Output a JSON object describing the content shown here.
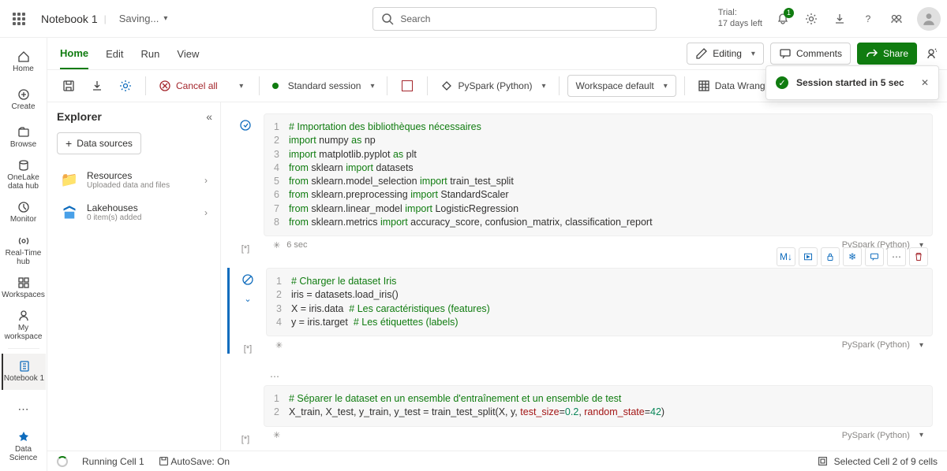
{
  "topbar": {
    "notebook_name": "Notebook 1",
    "saving": "Saving...",
    "search_placeholder": "Search",
    "trial_line1": "Trial:",
    "trial_line2": "17 days left",
    "notif_count": "1"
  },
  "rail": {
    "items": [
      {
        "label": "Home"
      },
      {
        "label": "Create"
      },
      {
        "label": "Browse"
      },
      {
        "label": "OneLake data hub"
      },
      {
        "label": "Monitor"
      },
      {
        "label": "Real-Time hub"
      },
      {
        "label": "Workspaces"
      },
      {
        "label": "My workspace"
      },
      {
        "label": "Notebook 1"
      }
    ],
    "switcher": "Data Science"
  },
  "tabs": {
    "home": "Home",
    "edit": "Edit",
    "run": "Run",
    "view": "View",
    "editing": "Editing",
    "comments": "Comments",
    "share": "Share",
    "copilot": "Copilot"
  },
  "toolbar": {
    "cancel_all": "Cancel all",
    "session": "Standard session",
    "kernel": "PySpark (Python)",
    "env": "Workspace default",
    "dw": "Data Wrangler"
  },
  "toast": {
    "text": "Session started in 5 sec"
  },
  "explorer": {
    "title": "Explorer",
    "data_sources": "Data sources",
    "resources": {
      "t": "Resources",
      "s": "Uploaded data and files"
    },
    "lakehouses": {
      "t": "Lakehouses",
      "s": "0 item(s) added"
    }
  },
  "cells": {
    "lang": "PySpark (Python)",
    "ctb": {
      "md": "M↓"
    },
    "c1": {
      "exec_time": "6 sec",
      "lines": [
        "1",
        "2",
        "3",
        "4",
        "5",
        "6",
        "7",
        "8"
      ],
      "l1_cm": "# Importation des bibliothèques nécessaires",
      "l2a": "import",
      "l2b": " numpy ",
      "l2c": "as",
      "l2d": " np",
      "l3a": "import",
      "l3b": " matplotlib.pyplot ",
      "l3c": "as",
      "l3d": " plt",
      "l4a": "from",
      "l4b": " sklearn ",
      "l4c": "import",
      "l4d": " datasets",
      "l5a": "from",
      "l5b": " sklearn.model_selection ",
      "l5c": "import",
      "l5d": " train_test_split",
      "l6a": "from",
      "l6b": " sklearn.preprocessing ",
      "l6c": "import",
      "l6d": " StandardScaler",
      "l7a": "from",
      "l7b": " sklearn.linear_model ",
      "l7c": "import",
      "l7d": " LogisticRegression",
      "l8a": "from",
      "l8b": " sklearn.metrics ",
      "l8c": "import",
      "l8d": " accuracy_score, confusion_matrix, classification_report",
      "marker": "[*]"
    },
    "c2": {
      "lines": [
        "1",
        "2",
        "3",
        "4"
      ],
      "l1": "# Charger le dataset Iris",
      "l2": "iris = datasets.load_iris()",
      "l3a": "X = iris.data  ",
      "l3b": "# Les caractéristiques (features)",
      "l4a": "y = iris.target  ",
      "l4b": "# Les étiquettes (labels)",
      "marker": "[*]"
    },
    "c3": {
      "lines": [
        "1",
        "2"
      ],
      "l1": "# Séparer le dataset en un ensemble d'entraînement et un ensemble de test",
      "l2a": "X_train, X_test, y_train, y_test = train_test_split(X, y, ",
      "l2b": "test_size",
      "l2c": "=",
      "l2d": "0.2",
      "l2e": ", ",
      "l2f": "random_state",
      "l2g": "=",
      "l2h": "42",
      "l2i": ")",
      "marker": "[*]"
    }
  },
  "statusbar": {
    "running": "Running Cell 1",
    "autosave": "AutoSave: On",
    "sel": "Selected Cell 2 of 9 cells"
  }
}
